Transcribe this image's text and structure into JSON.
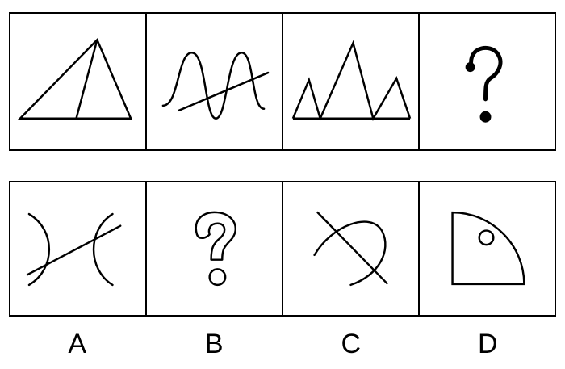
{
  "question_row": {
    "figures": [
      {
        "icon": "triangle-with-inner-line-icon"
      },
      {
        "icon": "wave-crossed-by-line-icon"
      },
      {
        "icon": "three-peaks-icon"
      },
      {
        "icon": "question-mark-icon",
        "text": "?"
      }
    ]
  },
  "options_row": {
    "figures": [
      {
        "icon": "two-arcs-crossed-line-icon"
      },
      {
        "icon": "outlined-question-mark-icon"
      },
      {
        "icon": "arc-crossed-line-icon"
      },
      {
        "icon": "quarter-circle-with-circle-icon"
      }
    ],
    "labels": [
      "A",
      "B",
      "C",
      "D"
    ]
  }
}
